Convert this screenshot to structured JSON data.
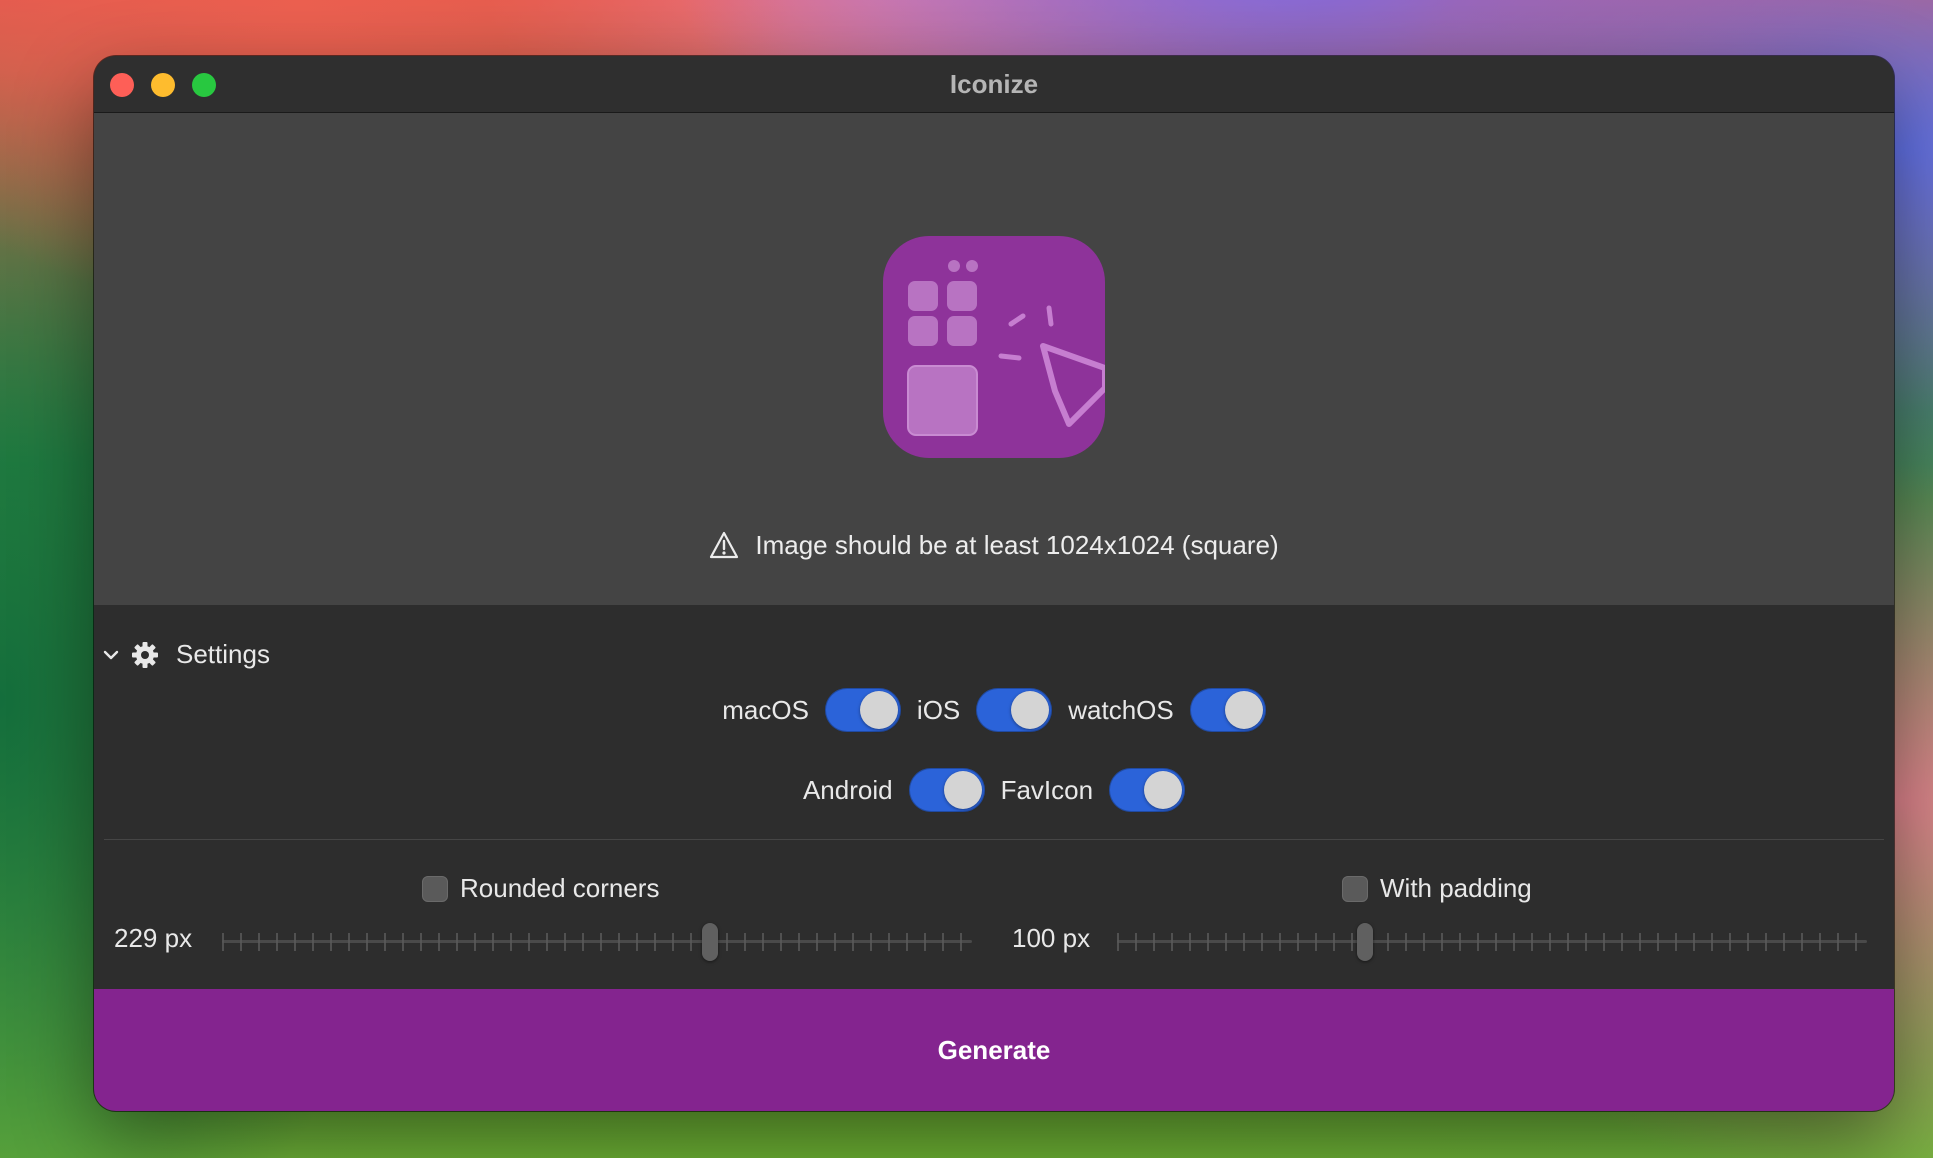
{
  "window": {
    "title": "Iconize"
  },
  "icons": {
    "close": "close-light",
    "minimize": "minimize-light",
    "zoom": "zoom-light",
    "warning": "warning-triangle-icon",
    "settings": "gear-icon",
    "disclosure": "chevron-down-icon"
  },
  "colors": {
    "accent": "#84248f",
    "icon_bg": "#8e339a",
    "toggle_on": "#2b63d9",
    "window_bg": "#2d2d2d",
    "drop_bg": "#444444"
  },
  "warning": {
    "text": "Image should be at least 1024x1024 (square)"
  },
  "settings": {
    "title": "Settings",
    "platforms": [
      {
        "label": "macOS",
        "on": true
      },
      {
        "label": "iOS",
        "on": true
      },
      {
        "label": "watchOS",
        "on": true
      },
      {
        "label": "Android",
        "on": true
      },
      {
        "label": "FavIcon",
        "on": true
      }
    ],
    "rounded_corners": {
      "label": "Rounded corners",
      "checked": false,
      "value_label": "229 px",
      "slider_fraction": 0.65
    },
    "padding": {
      "label": "With padding",
      "checked": false,
      "value_label": "100 px",
      "slider_fraction": 0.33
    }
  },
  "generate": {
    "label": "Generate"
  }
}
